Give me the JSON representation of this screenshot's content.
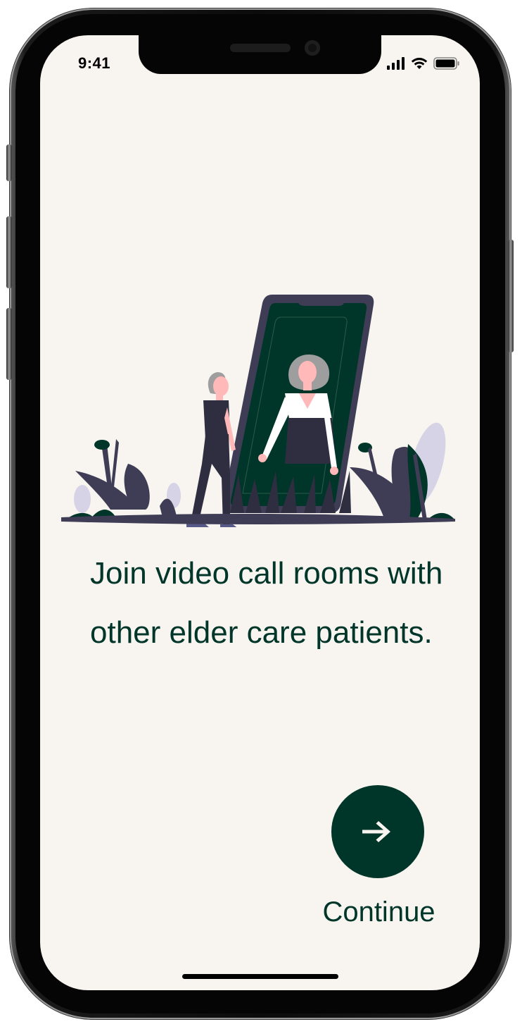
{
  "status_bar": {
    "time": "9:41"
  },
  "onboarding": {
    "headline": "Join video call rooms with other elder care patients.",
    "continue_label": "Continue"
  },
  "icons": {
    "signal": "cellular-signal-icon",
    "wifi": "wifi-icon",
    "battery": "battery-icon",
    "continue": "arrow-right-icon"
  },
  "colors": {
    "background": "#f8f4ef",
    "primary": "#003629",
    "accent_purple": "#3f3d56"
  }
}
